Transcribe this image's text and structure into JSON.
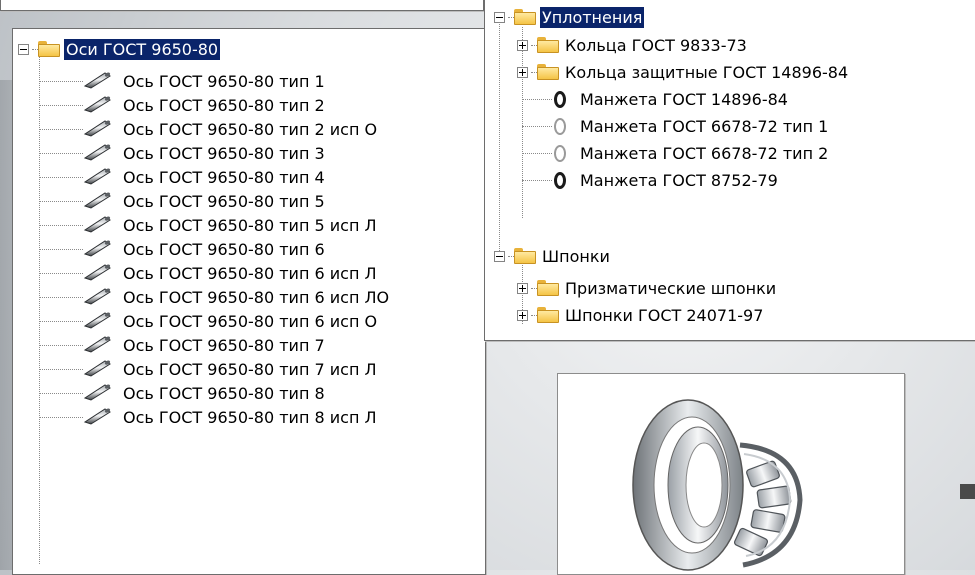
{
  "left_tree": {
    "root": {
      "label": "Оси ГОСТ 9650-80",
      "expanded": true,
      "selected": true,
      "icon": "folder-icon"
    },
    "items": [
      "Ось ГОСТ 9650-80 тип 1",
      "Ось ГОСТ 9650-80 тип 2",
      "Ось ГОСТ 9650-80 тип 2 исп О",
      "Ось ГОСТ 9650-80 тип 3",
      "Ось ГОСТ 9650-80 тип 4",
      "Ось ГОСТ 9650-80 тип 5",
      "Ось ГОСТ 9650-80 тип 5 исп Л",
      "Ось ГОСТ 9650-80 тип 6",
      "Ось ГОСТ 9650-80 тип 6  исп Л",
      "Ось ГОСТ 9650-80 тип 6 исп ЛО",
      "Ось ГОСТ 9650-80 тип 6 исп О",
      "Ось ГОСТ 9650-80 тип 7",
      "Ось ГОСТ 9650-80 тип 7 исп Л",
      "Ось ГОСТ 9650-80 тип 8",
      "Ось ГОСТ 9650-80 тип 8 исп Л"
    ],
    "item_icon": "axle-pin-icon"
  },
  "right_tree": {
    "seals": {
      "label": "Уплотнения",
      "expanded": true,
      "selected": true,
      "children": [
        {
          "label": "Кольца ГОСТ 9833-73",
          "type": "folder",
          "expanded": false
        },
        {
          "label": "Кольца защитные ГОСТ 14896-84",
          "type": "folder",
          "expanded": false
        },
        {
          "label": "Манжета ГОСТ 14896-84",
          "type": "ring-dark"
        },
        {
          "label": "Манжета ГОСТ 6678-72 тип 1",
          "type": "ring-light"
        },
        {
          "label": "Манжета ГОСТ 6678-72 тип 2",
          "type": "ring-light"
        },
        {
          "label": "Манжета ГОСТ 8752-79",
          "type": "ring-dark"
        }
      ]
    },
    "keys": {
      "label": "Шпонки",
      "expanded": true,
      "children": [
        {
          "label": "Призматические шпонки",
          "type": "folder",
          "expanded": false
        },
        {
          "label": "Шпонки ГОСТ 24071-97",
          "type": "folder",
          "expanded": false
        }
      ]
    }
  },
  "preview": {
    "icon": "roller-bearing-image"
  }
}
